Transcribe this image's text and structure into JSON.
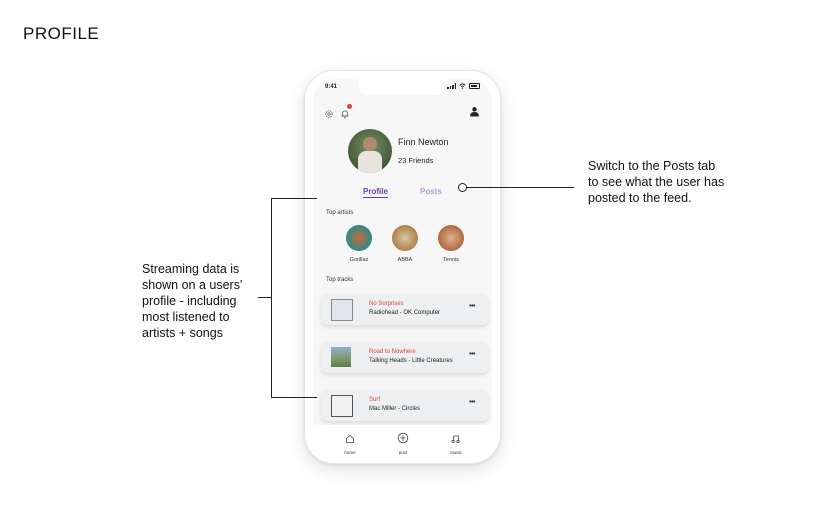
{
  "page": {
    "title": "PROFILE"
  },
  "status_bar": {
    "time": "9:41"
  },
  "profile": {
    "name": "Finn Newton",
    "friends": "23 Friends"
  },
  "tabs": {
    "profile": "Profile",
    "posts": "Posts"
  },
  "sections": {
    "top_artists": "Top artists",
    "top_tracks": "Top tracks"
  },
  "artists": [
    {
      "name": "Gorillaz"
    },
    {
      "name": "ABBA"
    },
    {
      "name": "Tennis"
    }
  ],
  "tracks": [
    {
      "title": "No Surprises",
      "artist_album": "Radiohead - OK Computer"
    },
    {
      "title": "Road to Nowhere",
      "artist_album": "Talking Heads - Little Creatures"
    },
    {
      "title": "Surf",
      "artist_album": "Mac Miller - Circles"
    }
  ],
  "nav": {
    "home": "home",
    "post": "post",
    "music": "music"
  },
  "annotations": {
    "posts_tab": "Switch to the Posts tab to see what the user has posted to the feed.",
    "streaming": "Streaming data is shown on a users' profile - including most listened to artists + songs"
  },
  "colors": {
    "accent": "#6a3fa0",
    "accent_light": "#b59ad0",
    "track_title": "#e0403a"
  },
  "icons": [
    "gear-icon",
    "bell-icon",
    "user-icon",
    "home-icon",
    "plus-circle-icon",
    "music-icon",
    "more-icon"
  ]
}
